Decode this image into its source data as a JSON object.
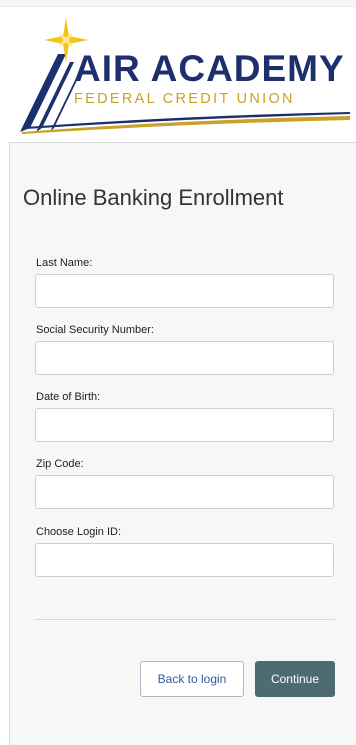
{
  "logo": {
    "name_main": "AIR ACADEMY",
    "name_sub": "FEDERAL CREDIT UNION",
    "colors": {
      "navy": "#1d2f6d",
      "gold": "#c9a227"
    }
  },
  "form": {
    "title": "Online Banking Enrollment",
    "fields": [
      {
        "label": "Last Name:",
        "value": "",
        "placeholder": ""
      },
      {
        "label": "Social Security Number:",
        "value": "",
        "placeholder": ""
      },
      {
        "label": "Date of Birth:",
        "value": "",
        "placeholder": ""
      },
      {
        "label": "Zip Code:",
        "value": "",
        "placeholder": ""
      },
      {
        "label": "Choose Login ID:",
        "value": "",
        "placeholder": ""
      }
    ]
  },
  "actions": {
    "back_label": "Back to login",
    "continue_label": "Continue"
  },
  "colors": {
    "continue_bg": "#4e6a72",
    "back_text": "#2a5d9f"
  }
}
